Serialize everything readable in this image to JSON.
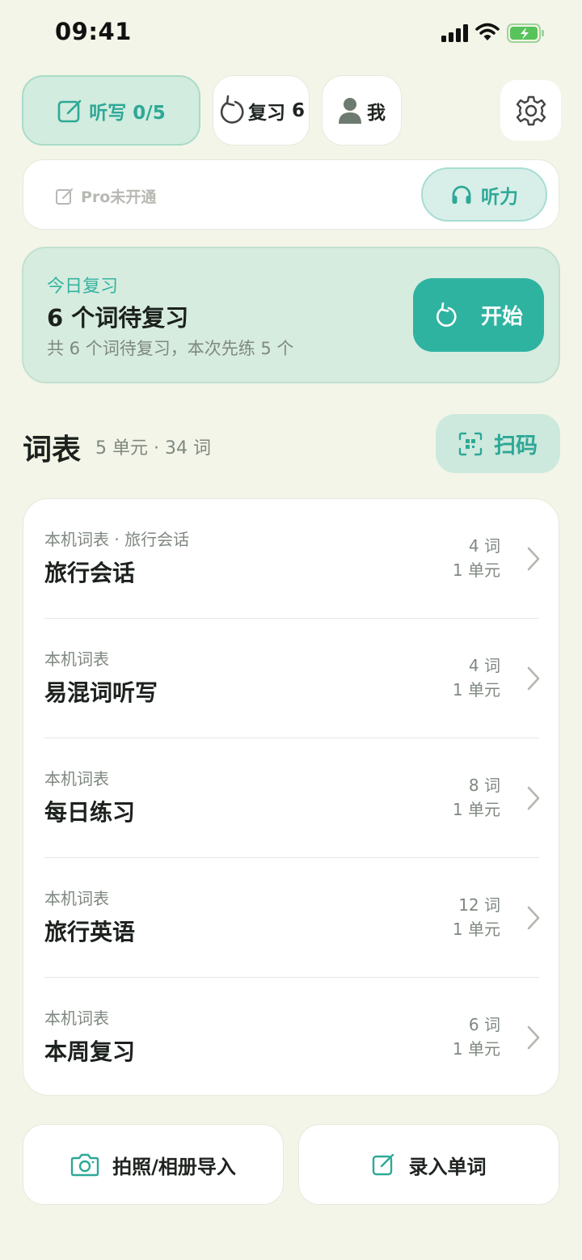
{
  "status_bar": {
    "time": "09:41"
  },
  "top_nav": {
    "dictation_label": "听写 0/5",
    "review_label": "复习",
    "review_count": "6",
    "me_label": "我"
  },
  "pro_bar": {
    "pro_label": "Pro未开通",
    "listening_label": "听力"
  },
  "review_card": {
    "tag": "今日复习",
    "title": "6 个词待复习",
    "subtitle": "共 6 个词待复习，本次先练 5 个",
    "start_label": "开始"
  },
  "wordlist_section": {
    "title": "词表",
    "count": "5 单元 · 34 词",
    "scan_label": "扫码"
  },
  "wordlists": [
    {
      "meta": "本机词表 · 旅行会话",
      "name": "旅行会话",
      "words": "4 词",
      "units": "1 单元"
    },
    {
      "meta": "本机词表",
      "name": "易混词听写",
      "words": "4 词",
      "units": "1 单元"
    },
    {
      "meta": "本机词表",
      "name": "每日练习",
      "words": "8 词",
      "units": "1 单元"
    },
    {
      "meta": "本机词表",
      "name": "旅行英语",
      "words": "12 词",
      "units": "1 单元"
    },
    {
      "meta": "本机词表",
      "name": "本周复习",
      "words": "6 词",
      "units": "1 单元"
    }
  ],
  "bottom_actions": {
    "import_label": "拍照/相册导入",
    "enter_label": "录入单词"
  },
  "colors": {
    "accent": "#2fb3a1",
    "background": "#f3f5e8",
    "card_mint": "#d6ecdf"
  },
  "icons": [
    "signal-icon",
    "wifi-icon",
    "battery-icon",
    "edit-icon",
    "refresh-icon",
    "person-icon",
    "gear-icon",
    "headphones-icon",
    "qr-scan-icon",
    "chevron-right-icon",
    "camera-icon"
  ]
}
